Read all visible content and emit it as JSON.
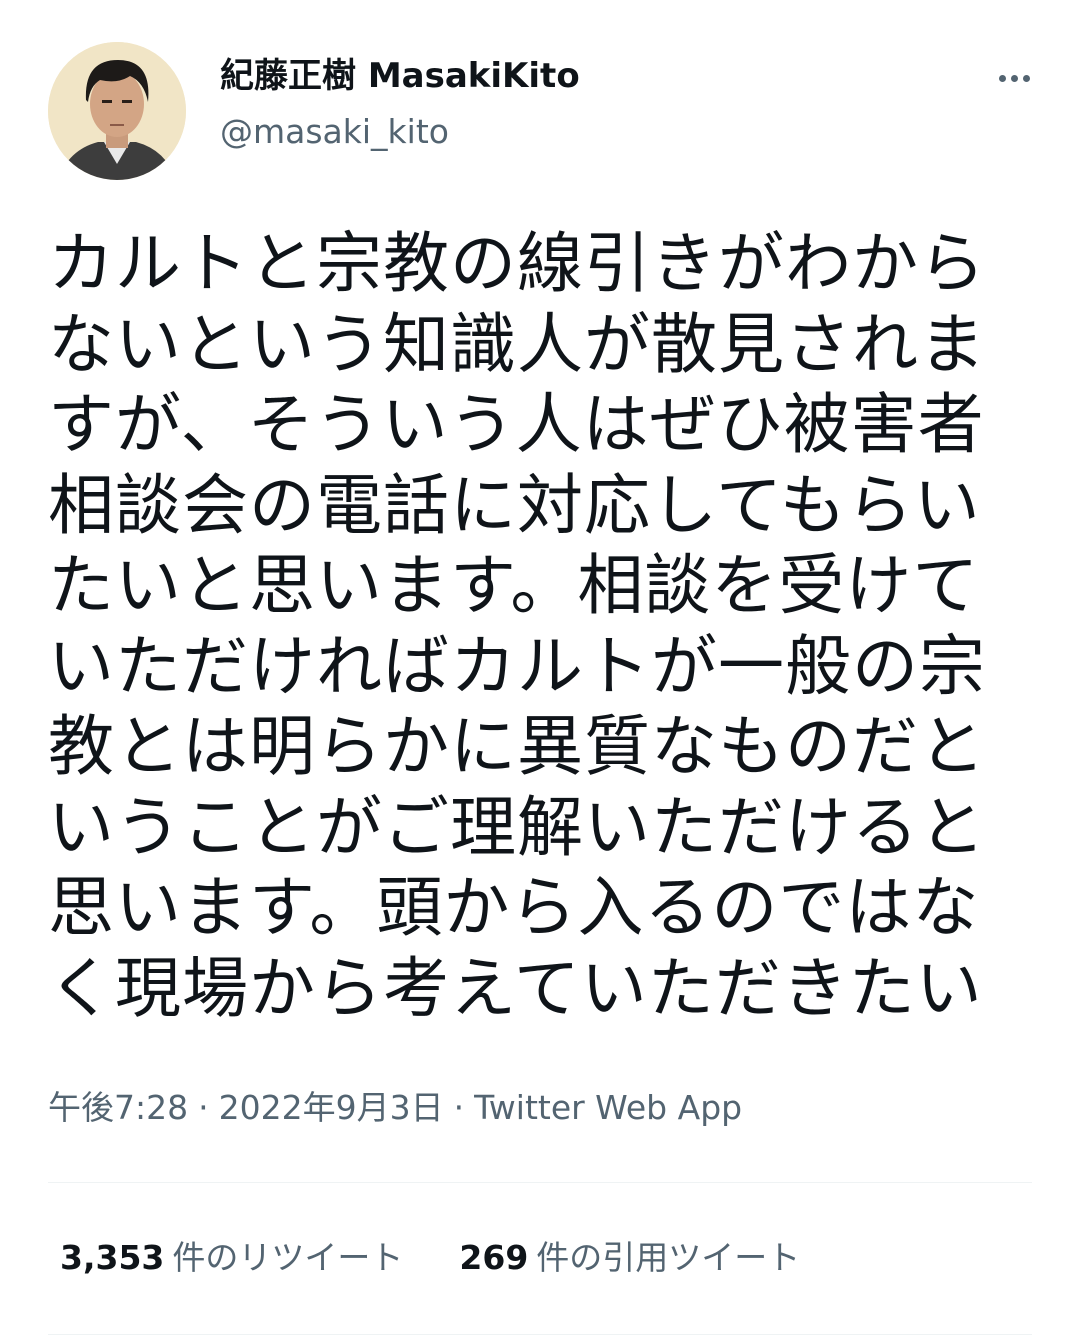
{
  "author": {
    "display_name": "紀藤正樹 MasakiKito",
    "handle": "@masaki_kito"
  },
  "more_icon": "more-horizontal-icon",
  "tweet": {
    "lines": [
      "カルトと宗教の線引きがわから",
      "ないという知識人が散見されま",
      "すが、そういう人はぜひ被害者",
      "相談会の電話に対応してもらい",
      "たいと思います。相談を受けて",
      "いただければカルトが一般の宗",
      "教とは明らかに異質なものだと",
      "いうことがご理解いただけると",
      "思います。頭から入るのではな",
      "く現場から考えていただきたい"
    ]
  },
  "meta": {
    "time": "午後7:28",
    "separator": "·",
    "date": "2022年9月3日",
    "source": "Twitter Web App"
  },
  "stats": {
    "retweets_count": "3,353",
    "retweets_label": "件のリツイート",
    "quotes_count": "269",
    "quotes_label": "件の引用ツイート"
  },
  "colors": {
    "text_primary": "#0f1419",
    "text_secondary": "#536471",
    "divider": "#eff3f4"
  }
}
